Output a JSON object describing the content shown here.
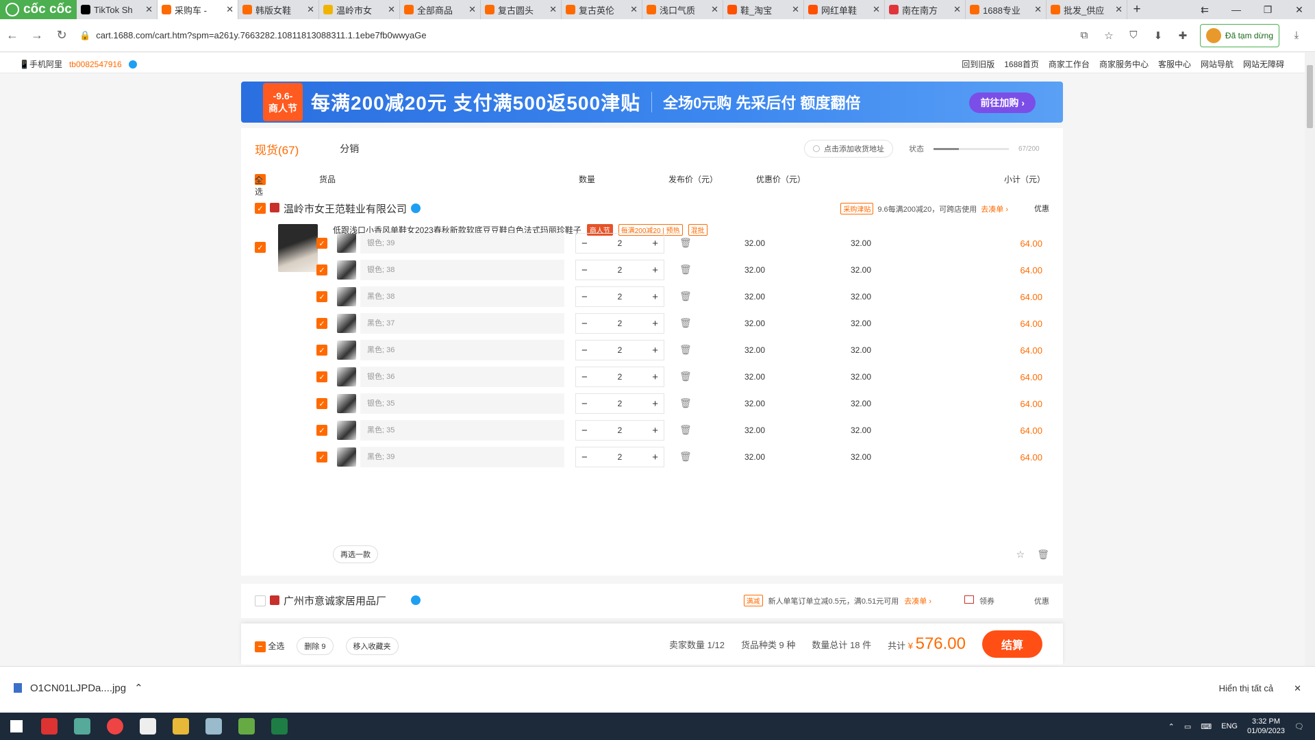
{
  "browser": {
    "brand": "cốc cốc",
    "tabs": [
      {
        "label": "TikTok Sh",
        "color": "#000000"
      },
      {
        "label": "采购车 -",
        "color": "#ff6a00",
        "active": true
      },
      {
        "label": "韩版女鞋",
        "color": "#ff6a00"
      },
      {
        "label": "温岭市女",
        "color": "#f0b400"
      },
      {
        "label": "全部商品",
        "color": "#ff6a00"
      },
      {
        "label": "复古圆头",
        "color": "#ff6a00"
      },
      {
        "label": "复古英伦",
        "color": "#ff6a00"
      },
      {
        "label": "浅口气质",
        "color": "#ff6a00"
      },
      {
        "label": "鞋_淘宝",
        "color": "#ff5000"
      },
      {
        "label": "网红单鞋",
        "color": "#ff5000"
      },
      {
        "label": "南在南方",
        "color": "#e0343a"
      },
      {
        "label": "1688专业",
        "color": "#ff6a00"
      },
      {
        "label": "批发_供应",
        "color": "#ff6a00"
      }
    ],
    "url": "cart.1688.com/cart.htm?spm=a261y.7663282.10811813088311.1.1ebe7fb0wwyaGe",
    "pause_label": "Đã tạm dừng"
  },
  "topbar": {
    "mobile": "手机阿里",
    "user": "tb0082547916",
    "links": [
      "回到旧版",
      "1688首页",
      "商家工作台",
      "商家服务中心",
      "客服中心",
      "网站导航",
      "网站无障碍"
    ]
  },
  "banner": {
    "badge_top": "-9.6-",
    "badge_bottom": "商人节",
    "main": "每满200减20元  支付满500返500津贴",
    "sub": "全场0元购 先采后付 额度翻倍",
    "cta": "前往加购"
  },
  "cart": {
    "tab_active": "现货(67)",
    "tab_other": "分销",
    "add_address": "点击添加收货地址",
    "status_label": "状态",
    "status_count": "67/200",
    "status_fraction": 0.335,
    "headers": {
      "select_all": "全选",
      "goods": "货品",
      "qty": "数量",
      "price": "发布价（元）",
      "discount": "优惠价（元）",
      "subtotal": "小计（元）"
    },
    "shop1": {
      "name": "温岭市女王范鞋业有限公司",
      "promo_tag": "采购津贴",
      "promo_text": "9.6每满200减20，可跨店使用",
      "promo_link": "去凑单",
      "benefit": "优惠",
      "product_title": "低跟浅口小香风单鞋女2023春秋新款软底豆豆鞋白色法式玛丽珍鞋子",
      "tags": [
        "商人节",
        "每满200减20",
        "预热",
        "混批"
      ],
      "rows": [
        {
          "spec": "银色; 39",
          "qty": "2",
          "price": "32.00",
          "discount": "32.00",
          "subtotal": "64.00"
        },
        {
          "spec": "银色; 38",
          "qty": "2",
          "price": "32.00",
          "discount": "32.00",
          "subtotal": "64.00"
        },
        {
          "spec": "黑色; 38",
          "qty": "2",
          "price": "32.00",
          "discount": "32.00",
          "subtotal": "64.00"
        },
        {
          "spec": "黑色; 37",
          "qty": "2",
          "price": "32.00",
          "discount": "32.00",
          "subtotal": "64.00"
        },
        {
          "spec": "黑色; 36",
          "qty": "2",
          "price": "32.00",
          "discount": "32.00",
          "subtotal": "64.00"
        },
        {
          "spec": "银色; 36",
          "qty": "2",
          "price": "32.00",
          "discount": "32.00",
          "subtotal": "64.00"
        },
        {
          "spec": "银色; 35",
          "qty": "2",
          "price": "32.00",
          "discount": "32.00",
          "subtotal": "64.00"
        },
        {
          "spec": "黑色; 35",
          "qty": "2",
          "price": "32.00",
          "discount": "32.00",
          "subtotal": "64.00"
        },
        {
          "spec": "黑色; 39",
          "qty": "2",
          "price": "32.00",
          "discount": "32.00",
          "subtotal": "64.00"
        }
      ],
      "reselect": "再选一款"
    },
    "shop2": {
      "name": "广州市意诚家居用品厂",
      "promo_tag": "满减",
      "promo_text": "新人单笔订单立减0.5元，满0.51元可用",
      "promo_link": "去凑单",
      "coupon": "领券",
      "benefit": "优惠"
    },
    "footer": {
      "select_all": "全选",
      "delete": "删除 9",
      "move_fav": "移入收藏夹",
      "sellers": "卖家数量 1/12",
      "kinds": "货品种类 9 种",
      "items": "数量总计 18 件",
      "total_label": "共计",
      "currency": "¥",
      "total": "576.00",
      "settle": "结算"
    }
  },
  "download": {
    "file": "O1CN01LJPDa....jpg",
    "show_all": "Hiển thị tất cả"
  },
  "taskbar": {
    "lang": "ENG",
    "time": "3:32 PM",
    "date": "01/09/2023"
  }
}
